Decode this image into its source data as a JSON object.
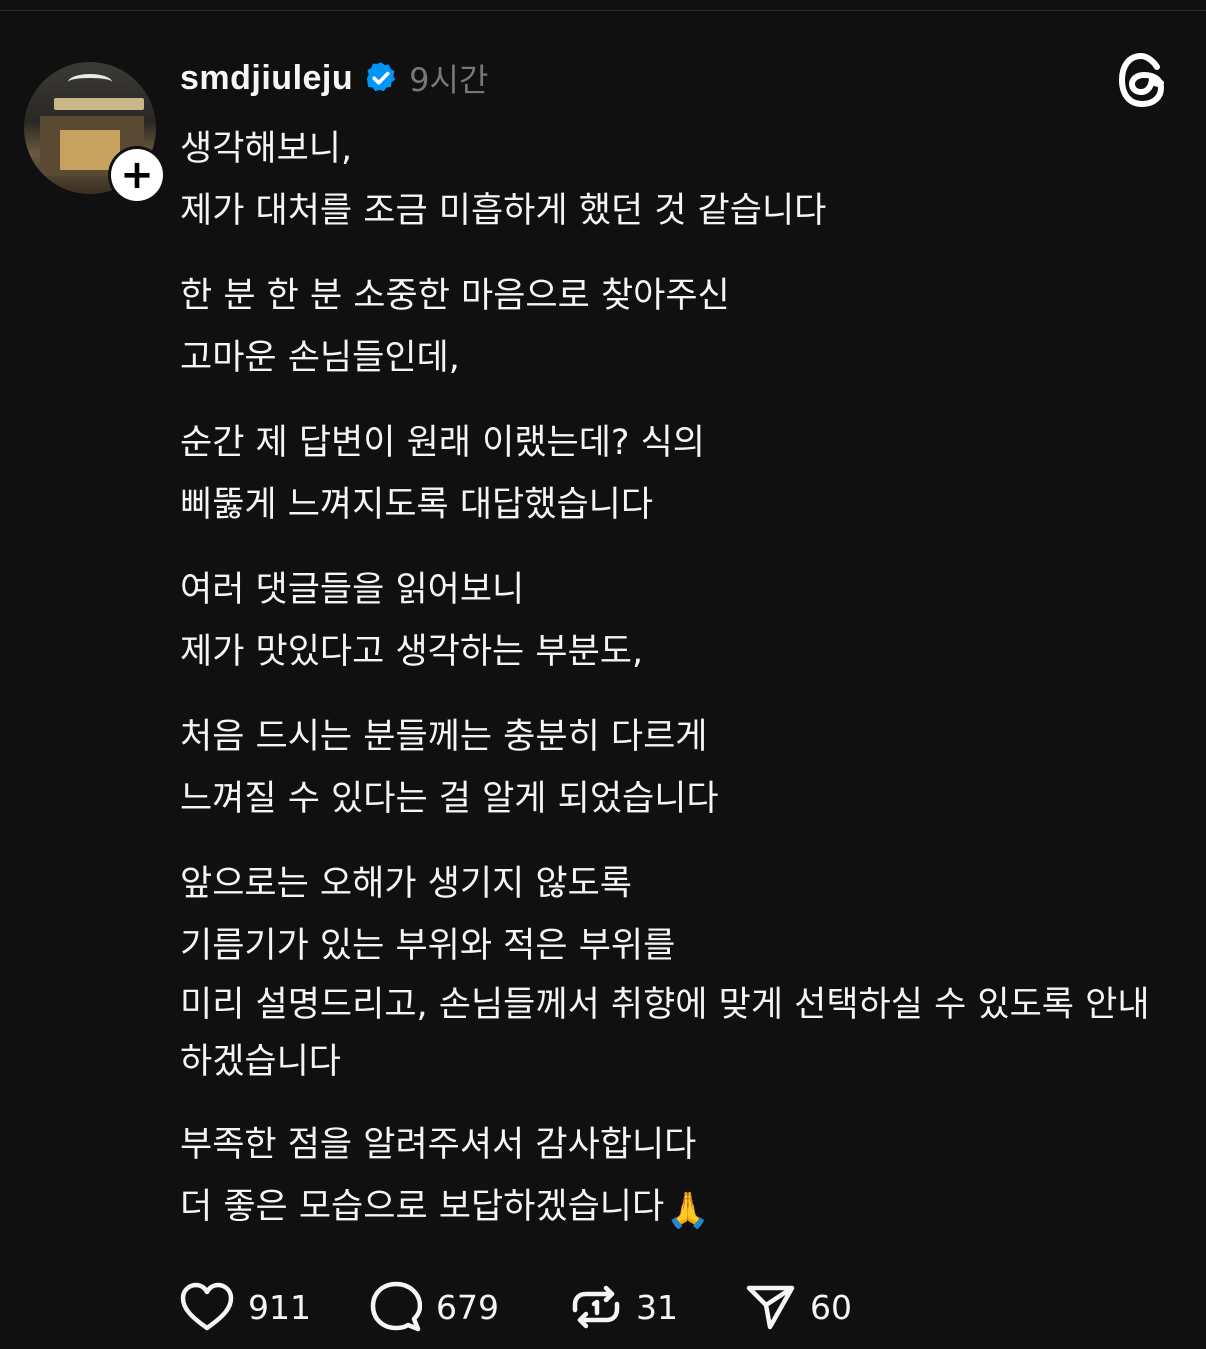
{
  "post": {
    "username": "smdjiuleju",
    "timestamp": "9시간",
    "paragraphs": [
      [
        "생각해보니,",
        "제가 대처를 조금 미흡하게 했던 것 같습니다"
      ],
      [
        "한 분 한 분 소중한 마음으로 찾아주신",
        "고마운 손님들인데,"
      ],
      [
        "순간 제 답변이 원래 이랬는데? 식의",
        "삐뚫게 느껴지도록 대답했습니다"
      ],
      [
        "여러 댓글들을 읽어보니",
        "제가 맛있다고 생각하는 부분도,"
      ],
      [
        "처음 드시는 분들께는 충분히 다르게",
        "느껴질 수 있다는 걸 알게 되었습니다"
      ],
      [
        "앞으로는 오해가 생기지 않도록",
        "기름기가 있는 부위와 적은 부위를",
        "미리 설명드리고, 손님들께서 취향에 맞게 선택하실 수 있도록 안내하겠습니다"
      ],
      [
        "부족한 점을 알려주셔서 감사합니다",
        "더 좋은 모습으로 보답하겠습니다"
      ]
    ],
    "closing_emoji": "🙏"
  },
  "actions": {
    "likes": "911",
    "replies": "679",
    "reposts": "31",
    "shares": "60"
  },
  "icons": {
    "verified": "verified-badge-icon",
    "threads": "threads-logo-icon",
    "like": "heart-icon",
    "reply": "comment-icon",
    "repost": "repost-icon",
    "share": "send-icon"
  },
  "colors": {
    "background": "#101010",
    "text": "#f3f5f7",
    "muted": "#777777",
    "verified": "#0095f6"
  }
}
